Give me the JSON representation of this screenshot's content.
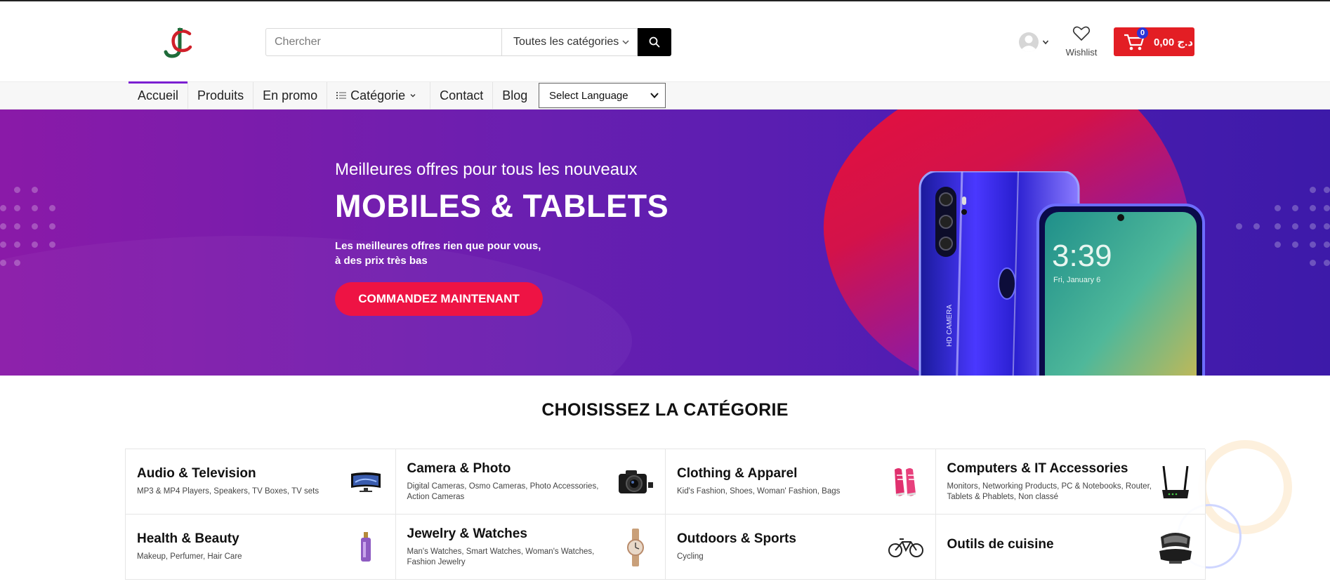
{
  "header": {
    "logo_alt": "JC",
    "search": {
      "placeholder": "Chercher",
      "category_label": "Toutes les catégories"
    },
    "wishlist_label": "Wishlist",
    "cart": {
      "count": "0",
      "total": "0,00 د.ج"
    }
  },
  "nav": {
    "items": [
      {
        "label": "Accueil",
        "active": true
      },
      {
        "label": "Produits"
      },
      {
        "label": "En promo"
      },
      {
        "label": "Catégorie"
      },
      {
        "label": "Contact"
      },
      {
        "label": "Blog"
      }
    ],
    "language_label": "Select Language"
  },
  "hero": {
    "subtitle": "Meilleures offres pour tous les nouveaux",
    "title": "MOBILES & TABLETS",
    "desc_line1": "Les meilleures offres rien que pour vous,",
    "desc_line2": "à des prix très bas",
    "cta": "COMMANDEZ MAINTENANT",
    "phone_screen_time": "3:39",
    "phone_screen_date": "Fri, January 6",
    "phone_back_text": "HD CAMERA",
    "colors": {
      "accent": "#ee1344",
      "bg_start": "#8a1aa8",
      "bg_end": "#3d1aa9"
    }
  },
  "categories": {
    "title": "CHOISISSEZ LA CATÉGORIE",
    "items": [
      {
        "name": "Audio & Television",
        "subs": "MP3 & MP4 Players, Speakers, TV Boxes, TV sets",
        "icon": "tv-icon"
      },
      {
        "name": "Camera & Photo",
        "subs": "Digital Cameras, Osmo Cameras, Photo Accessories, Action Cameras",
        "icon": "camera-icon"
      },
      {
        "name": "Clothing & Apparel",
        "subs": "Kid's Fashion, Shoes, Woman' Fashion, Bags",
        "icon": "sneakers-icon"
      },
      {
        "name": "Computers & IT Accessories",
        "subs": "Monitors, Networking Products, PC & Notebooks, Router, Tablets & Phablets, Non classé",
        "icon": "router-icon"
      },
      {
        "name": "Health & Beauty",
        "subs": "Makeup, Perfumer, Hair Care",
        "icon": "perfume-icon"
      },
      {
        "name": "Jewelry & Watches",
        "subs": "Man's Watches, Smart Watches, Woman's Watches, Fashion Jewelry",
        "icon": "watch-icon"
      },
      {
        "name": "Outdoors & Sports",
        "subs": "Cycling",
        "icon": "bicycle-icon"
      },
      {
        "name": "Outils de cuisine",
        "subs": "",
        "icon": "grill-icon"
      }
    ]
  }
}
